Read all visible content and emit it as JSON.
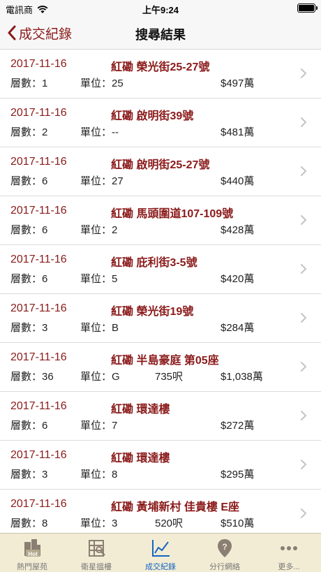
{
  "status_bar": {
    "carrier": "電訊商",
    "time": "上午9:24"
  },
  "nav": {
    "back_label": "成交紀錄",
    "title": "搜尋結果"
  },
  "unit_prefix": "單位：",
  "floor_prefix": "層數：",
  "records": [
    {
      "date": "2017-11-16",
      "address": "紅磡 榮光街25-27號",
      "floor": "層數：1",
      "unit": "單位：25",
      "area": "",
      "price": "$497萬"
    },
    {
      "date": "2017-11-16",
      "address": "紅磡 啟明街39號",
      "floor": "層數：2",
      "unit": "單位：--",
      "area": "",
      "price": "$481萬"
    },
    {
      "date": "2017-11-16",
      "address": "紅磡 啟明街25-27號",
      "floor": "層數：6",
      "unit": "單位：27",
      "area": "",
      "price": "$440萬"
    },
    {
      "date": "2017-11-16",
      "address": "紅磡 馬頭圍道107-109號",
      "floor": "層數：6",
      "unit": "單位：2",
      "area": "",
      "price": "$428萬"
    },
    {
      "date": "2017-11-16",
      "address": "紅磡 庇利街3-5號",
      "floor": "層數：6",
      "unit": "單位：5",
      "area": "",
      "price": "$420萬"
    },
    {
      "date": "2017-11-16",
      "address": "紅磡 榮光街19號",
      "floor": "層數：3",
      "unit": "單位：B",
      "area": "",
      "price": "$284萬"
    },
    {
      "date": "2017-11-16",
      "address": "紅磡 半島豪庭 第05座",
      "floor": "層數：36",
      "unit": "單位：G",
      "area": "735呎",
      "price": "$1,038萬"
    },
    {
      "date": "2017-11-16",
      "address": "紅磡 環達樓",
      "floor": "層數：6",
      "unit": "單位：7",
      "area": "",
      "price": "$272萬"
    },
    {
      "date": "2017-11-16",
      "address": "紅磡 環達樓",
      "floor": "層數：3",
      "unit": "單位：8",
      "area": "",
      "price": "$295萬"
    },
    {
      "date": "2017-11-16",
      "address": "紅磡 黃埔新村 佳貴樓 E座",
      "floor": "層數：8",
      "unit": "單位：3",
      "area": "520呎",
      "price": "$510萬"
    }
  ],
  "tabs": [
    {
      "label": "熱門屋苑",
      "icon": "hot-building-icon",
      "active": false
    },
    {
      "label": "衛星搵樓",
      "icon": "satellite-search-icon",
      "active": false
    },
    {
      "label": "成交紀錄",
      "icon": "line-chart-icon",
      "active": true
    },
    {
      "label": "分行網絡",
      "icon": "branch-location-icon",
      "active": false
    },
    {
      "label": "更多...",
      "icon": "more-dots-icon",
      "active": false
    }
  ],
  "colors": {
    "accent": "#8b1a1a",
    "tab_active": "#1565c0",
    "tab_bg": "#f3ecd5"
  }
}
